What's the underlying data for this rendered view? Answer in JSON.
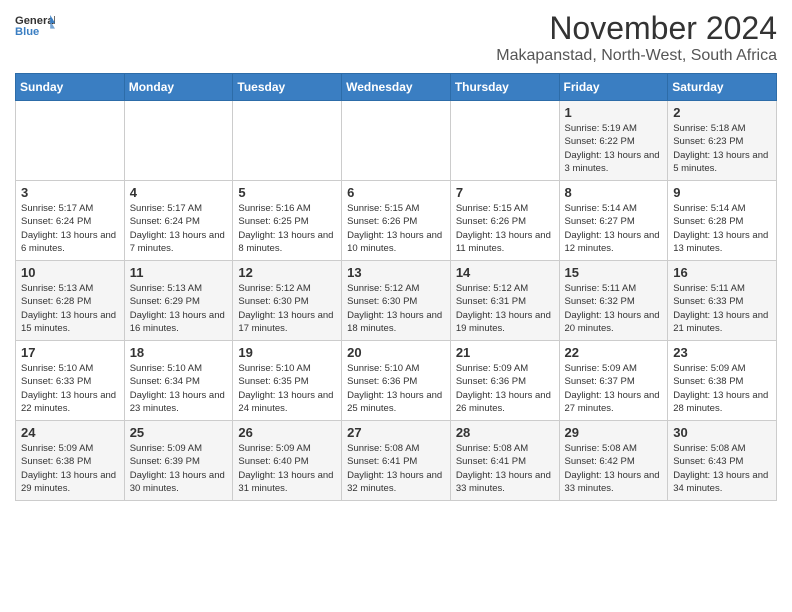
{
  "header": {
    "logo_general": "General",
    "logo_blue": "Blue",
    "main_title": "November 2024",
    "subtitle": "Makapanstad, North-West, South Africa"
  },
  "calendar": {
    "days_of_week": [
      "Sunday",
      "Monday",
      "Tuesday",
      "Wednesday",
      "Thursday",
      "Friday",
      "Saturday"
    ],
    "weeks": [
      [
        {
          "day": "",
          "info": ""
        },
        {
          "day": "",
          "info": ""
        },
        {
          "day": "",
          "info": ""
        },
        {
          "day": "",
          "info": ""
        },
        {
          "day": "",
          "info": ""
        },
        {
          "day": "1",
          "info": "Sunrise: 5:19 AM\nSunset: 6:22 PM\nDaylight: 13 hours and 3 minutes."
        },
        {
          "day": "2",
          "info": "Sunrise: 5:18 AM\nSunset: 6:23 PM\nDaylight: 13 hours and 5 minutes."
        }
      ],
      [
        {
          "day": "3",
          "info": "Sunrise: 5:17 AM\nSunset: 6:24 PM\nDaylight: 13 hours and 6 minutes."
        },
        {
          "day": "4",
          "info": "Sunrise: 5:17 AM\nSunset: 6:24 PM\nDaylight: 13 hours and 7 minutes."
        },
        {
          "day": "5",
          "info": "Sunrise: 5:16 AM\nSunset: 6:25 PM\nDaylight: 13 hours and 8 minutes."
        },
        {
          "day": "6",
          "info": "Sunrise: 5:15 AM\nSunset: 6:26 PM\nDaylight: 13 hours and 10 minutes."
        },
        {
          "day": "7",
          "info": "Sunrise: 5:15 AM\nSunset: 6:26 PM\nDaylight: 13 hours and 11 minutes."
        },
        {
          "day": "8",
          "info": "Sunrise: 5:14 AM\nSunset: 6:27 PM\nDaylight: 13 hours and 12 minutes."
        },
        {
          "day": "9",
          "info": "Sunrise: 5:14 AM\nSunset: 6:28 PM\nDaylight: 13 hours and 13 minutes."
        }
      ],
      [
        {
          "day": "10",
          "info": "Sunrise: 5:13 AM\nSunset: 6:28 PM\nDaylight: 13 hours and 15 minutes."
        },
        {
          "day": "11",
          "info": "Sunrise: 5:13 AM\nSunset: 6:29 PM\nDaylight: 13 hours and 16 minutes."
        },
        {
          "day": "12",
          "info": "Sunrise: 5:12 AM\nSunset: 6:30 PM\nDaylight: 13 hours and 17 minutes."
        },
        {
          "day": "13",
          "info": "Sunrise: 5:12 AM\nSunset: 6:30 PM\nDaylight: 13 hours and 18 minutes."
        },
        {
          "day": "14",
          "info": "Sunrise: 5:12 AM\nSunset: 6:31 PM\nDaylight: 13 hours and 19 minutes."
        },
        {
          "day": "15",
          "info": "Sunrise: 5:11 AM\nSunset: 6:32 PM\nDaylight: 13 hours and 20 minutes."
        },
        {
          "day": "16",
          "info": "Sunrise: 5:11 AM\nSunset: 6:33 PM\nDaylight: 13 hours and 21 minutes."
        }
      ],
      [
        {
          "day": "17",
          "info": "Sunrise: 5:10 AM\nSunset: 6:33 PM\nDaylight: 13 hours and 22 minutes."
        },
        {
          "day": "18",
          "info": "Sunrise: 5:10 AM\nSunset: 6:34 PM\nDaylight: 13 hours and 23 minutes."
        },
        {
          "day": "19",
          "info": "Sunrise: 5:10 AM\nSunset: 6:35 PM\nDaylight: 13 hours and 24 minutes."
        },
        {
          "day": "20",
          "info": "Sunrise: 5:10 AM\nSunset: 6:36 PM\nDaylight: 13 hours and 25 minutes."
        },
        {
          "day": "21",
          "info": "Sunrise: 5:09 AM\nSunset: 6:36 PM\nDaylight: 13 hours and 26 minutes."
        },
        {
          "day": "22",
          "info": "Sunrise: 5:09 AM\nSunset: 6:37 PM\nDaylight: 13 hours and 27 minutes."
        },
        {
          "day": "23",
          "info": "Sunrise: 5:09 AM\nSunset: 6:38 PM\nDaylight: 13 hours and 28 minutes."
        }
      ],
      [
        {
          "day": "24",
          "info": "Sunrise: 5:09 AM\nSunset: 6:38 PM\nDaylight: 13 hours and 29 minutes."
        },
        {
          "day": "25",
          "info": "Sunrise: 5:09 AM\nSunset: 6:39 PM\nDaylight: 13 hours and 30 minutes."
        },
        {
          "day": "26",
          "info": "Sunrise: 5:09 AM\nSunset: 6:40 PM\nDaylight: 13 hours and 31 minutes."
        },
        {
          "day": "27",
          "info": "Sunrise: 5:08 AM\nSunset: 6:41 PM\nDaylight: 13 hours and 32 minutes."
        },
        {
          "day": "28",
          "info": "Sunrise: 5:08 AM\nSunset: 6:41 PM\nDaylight: 13 hours and 33 minutes."
        },
        {
          "day": "29",
          "info": "Sunrise: 5:08 AM\nSunset: 6:42 PM\nDaylight: 13 hours and 33 minutes."
        },
        {
          "day": "30",
          "info": "Sunrise: 5:08 AM\nSunset: 6:43 PM\nDaylight: 13 hours and 34 minutes."
        }
      ]
    ]
  }
}
